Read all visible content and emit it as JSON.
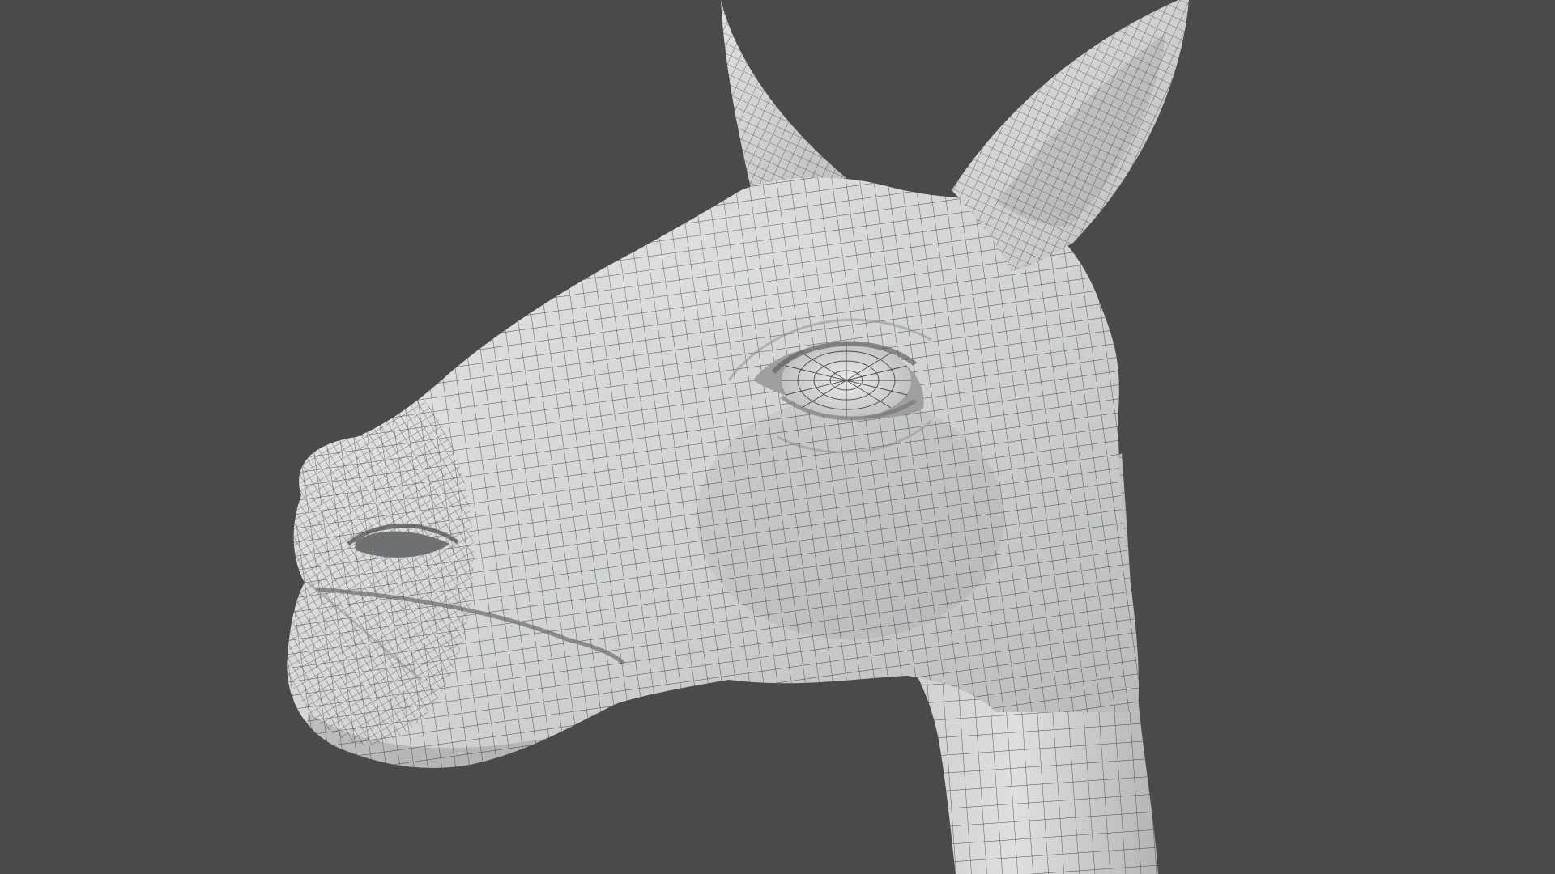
{
  "scene": {
    "subject": "llama-head-wireframe-render",
    "background_color": "#4a4a4a",
    "mesh_fill_color": "#d4d5d6",
    "mesh_shadow_color": "#a9aaab",
    "wire_color": "#2b2b2b",
    "view": "three-quarter-left"
  },
  "icons": {
    "eye": "eye-icon",
    "nostril": "nostril-icon"
  }
}
